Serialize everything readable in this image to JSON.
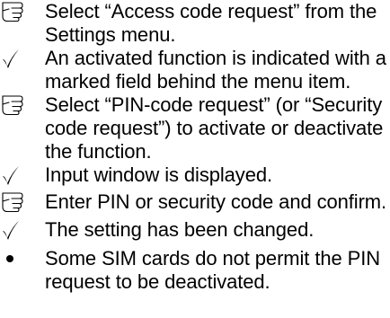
{
  "steps": [
    {
      "type": "instruction",
      "icon": "pointing-hand-icon",
      "text": "Select “Access code request” from the\nSettings menu."
    },
    {
      "type": "result",
      "icon": "checkmark-icon",
      "text": "An activated function is indicated with a\nmarked field behind the menu item."
    },
    {
      "type": "instruction",
      "icon": "pointing-hand-icon",
      "text": "Select “PIN-code request” (or “Security\ncode request”) to activate or deactivate\nthe function."
    },
    {
      "type": "result",
      "icon": "checkmark-icon",
      "text": "Input window is displayed."
    },
    {
      "type": "instruction",
      "icon": "pointing-hand-icon",
      "text": "Enter PIN or security code and confirm."
    },
    {
      "type": "result",
      "icon": "checkmark-icon",
      "text": "The setting has been changed."
    },
    {
      "type": "note",
      "icon": "bullet-icon",
      "text": "Some SIM cards do not permit the PIN\nrequest to be deactivated."
    }
  ]
}
